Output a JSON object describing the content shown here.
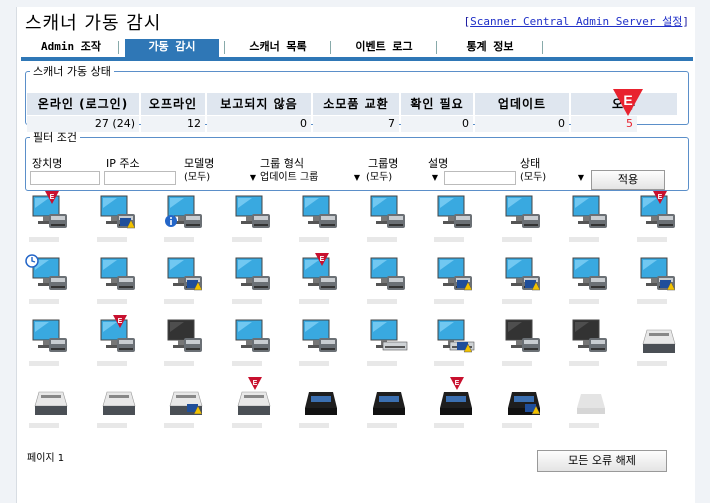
{
  "header": {
    "title": "스캐너 가동 감시",
    "admin_link_open": "[",
    "admin_link_text": "Scanner Central Admin Server 설정",
    "admin_link_close": "]"
  },
  "tabs": [
    {
      "label": "Admin 조작",
      "active": false
    },
    {
      "label": "가동 감시",
      "active": true
    },
    {
      "label": "스캐너 목록",
      "active": false
    },
    {
      "label": "이벤트 로그",
      "active": false
    },
    {
      "label": "통계 정보",
      "active": false
    }
  ],
  "status": {
    "legend": "스캐너 가동 상태",
    "columns": [
      {
        "header": "온라인 (로그인)",
        "value": "27 (24)"
      },
      {
        "header": "오프라인",
        "value": "12"
      },
      {
        "header": "보고되지 않음",
        "value": "0"
      },
      {
        "header": "소모품 교환",
        "value": "7"
      },
      {
        "header": "확인 필요",
        "value": "0"
      },
      {
        "header": "업데이트",
        "value": "0"
      },
      {
        "header": "오류",
        "value": "5"
      }
    ],
    "error_color": "#e8222e",
    "error_marker_letter": "E"
  },
  "filter": {
    "legend": "필터 조건",
    "device_name": {
      "label": "장치명",
      "value": ""
    },
    "ip": {
      "label": "IP 주소",
      "value": ""
    },
    "model": {
      "label": "모델명",
      "value": "(모두)"
    },
    "group_type": {
      "label": "그룹 형식",
      "value": "업데이트 그룹"
    },
    "group_name": {
      "label": "그룹명",
      "value": "(모두)"
    },
    "description": {
      "label": "설명",
      "value": ""
    },
    "state": {
      "label": "상태",
      "value": "(모두)"
    },
    "apply_label": "적용"
  },
  "scanners": [
    {
      "type": "monitor",
      "badge": "error"
    },
    {
      "type": "monitor",
      "badge": "consumable"
    },
    {
      "type": "monitor",
      "badge": "info"
    },
    {
      "type": "monitor",
      "badge": "none"
    },
    {
      "type": "monitor",
      "badge": "none"
    },
    {
      "type": "monitor",
      "badge": "none"
    },
    {
      "type": "monitor",
      "badge": "none"
    },
    {
      "type": "monitor",
      "badge": "none"
    },
    {
      "type": "monitor",
      "badge": "none"
    },
    {
      "type": "monitor",
      "badge": "error"
    },
    {
      "type": "monitor",
      "badge": "update"
    },
    {
      "type": "monitor",
      "badge": "none"
    },
    {
      "type": "monitor",
      "badge": "consumable"
    },
    {
      "type": "monitor",
      "badge": "none"
    },
    {
      "type": "monitor",
      "badge": "error"
    },
    {
      "type": "monitor",
      "badge": "none"
    },
    {
      "type": "monitor",
      "badge": "consumable"
    },
    {
      "type": "monitor",
      "badge": "consumable"
    },
    {
      "type": "monitor",
      "badge": "none"
    },
    {
      "type": "monitor",
      "badge": "consumable"
    },
    {
      "type": "monitor",
      "badge": "none"
    },
    {
      "type": "monitor",
      "badge": "error"
    },
    {
      "type": "monitor-dark",
      "badge": "none"
    },
    {
      "type": "monitor",
      "badge": "none"
    },
    {
      "type": "monitor",
      "badge": "none"
    },
    {
      "type": "monitor-flatbed",
      "badge": "none"
    },
    {
      "type": "monitor-flatbed",
      "badge": "consumable"
    },
    {
      "type": "monitor-dark",
      "badge": "none"
    },
    {
      "type": "monitor-dark",
      "badge": "none"
    },
    {
      "type": "scanner-white",
      "badge": "none"
    },
    {
      "type": "scanner-white",
      "badge": "none"
    },
    {
      "type": "scanner-white",
      "badge": "none"
    },
    {
      "type": "scanner-white",
      "badge": "consumable"
    },
    {
      "type": "scanner-white",
      "badge": "error"
    },
    {
      "type": "scanner-black",
      "badge": "none"
    },
    {
      "type": "scanner-black",
      "badge": "none"
    },
    {
      "type": "scanner-black",
      "badge": "error"
    },
    {
      "type": "scanner-black",
      "badge": "consumable"
    },
    {
      "type": "scanner-ghost",
      "badge": "none"
    }
  ],
  "footer": {
    "page_label": "페이지 1",
    "clear_errors_label": "모든 오류 해제"
  }
}
